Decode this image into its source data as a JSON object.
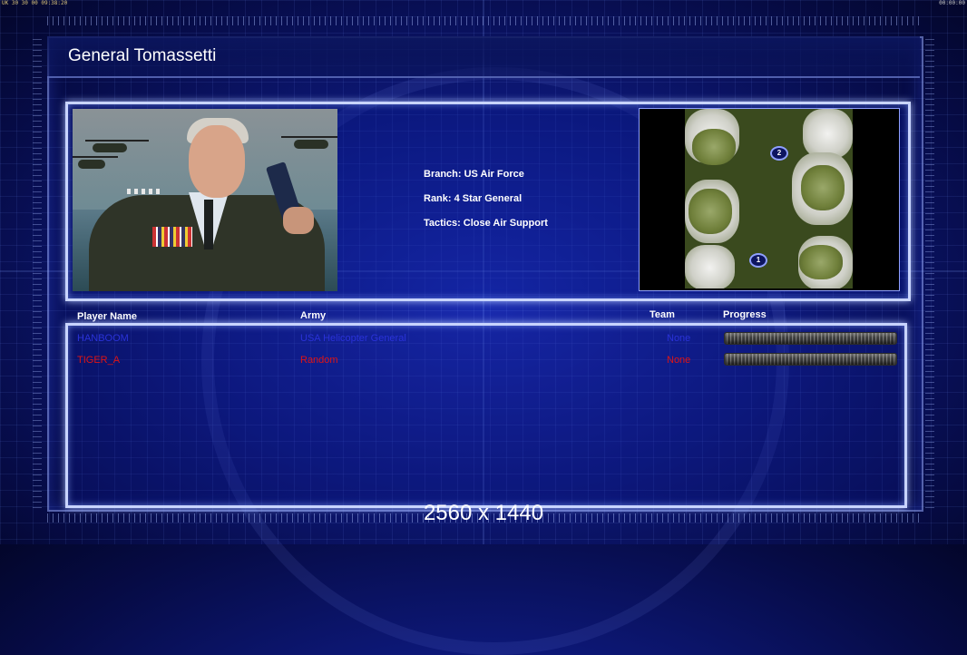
{
  "hud": {
    "left_readout": "UK 30 30 00 09:38:20",
    "right_readout": "00:00:00"
  },
  "general": {
    "title": "General Tomassetti",
    "branch": "Branch: US Air Force",
    "rank": "Rank: 4 Star General",
    "tactics": "Tactics: Close Air Support"
  },
  "map": {
    "markers": [
      "2",
      "1"
    ]
  },
  "players_table": {
    "headers": {
      "player_name": "Player Name",
      "army": "Army",
      "team": "Team",
      "progress": "Progress"
    },
    "rows": [
      {
        "player_name": "HANBOOM",
        "army": "USA Helicopter General",
        "team": "None",
        "color": "#2a32d8"
      },
      {
        "player_name": "TIGER_A",
        "army": "Random",
        "team": "None",
        "color": "#e01414"
      }
    ]
  },
  "resolution_label": "2560 x 1440"
}
